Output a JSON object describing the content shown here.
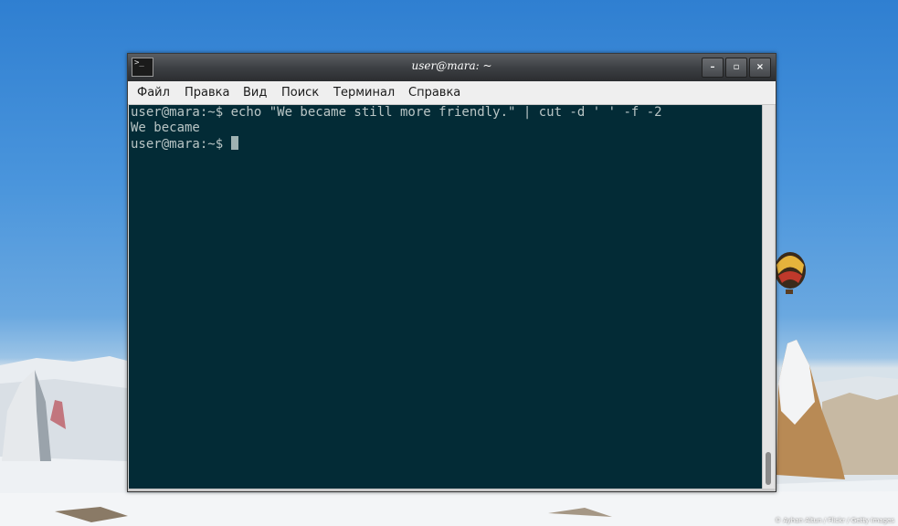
{
  "window": {
    "title": "user@mara: ~",
    "app_icon_glyph": ">_",
    "buttons": {
      "minimize": "–",
      "maximize": "▫",
      "close": "×"
    }
  },
  "menubar": {
    "items": [
      "Файл",
      "Правка",
      "Вид",
      "Поиск",
      "Терминал",
      "Справка"
    ]
  },
  "terminal": {
    "lines": [
      "user@mara:~$ echo \"We became still more friendly.\" | cut -d ' ' -f -2",
      "We became"
    ],
    "prompt": "user@mara:~$ "
  },
  "desktop": {
    "credit": "© Ayhan Altun / Flickr / Getty Images"
  },
  "colors": {
    "terminal_bg": "#032b36",
    "terminal_fg": "#b9c5c5",
    "sky": "#4a95dc"
  }
}
